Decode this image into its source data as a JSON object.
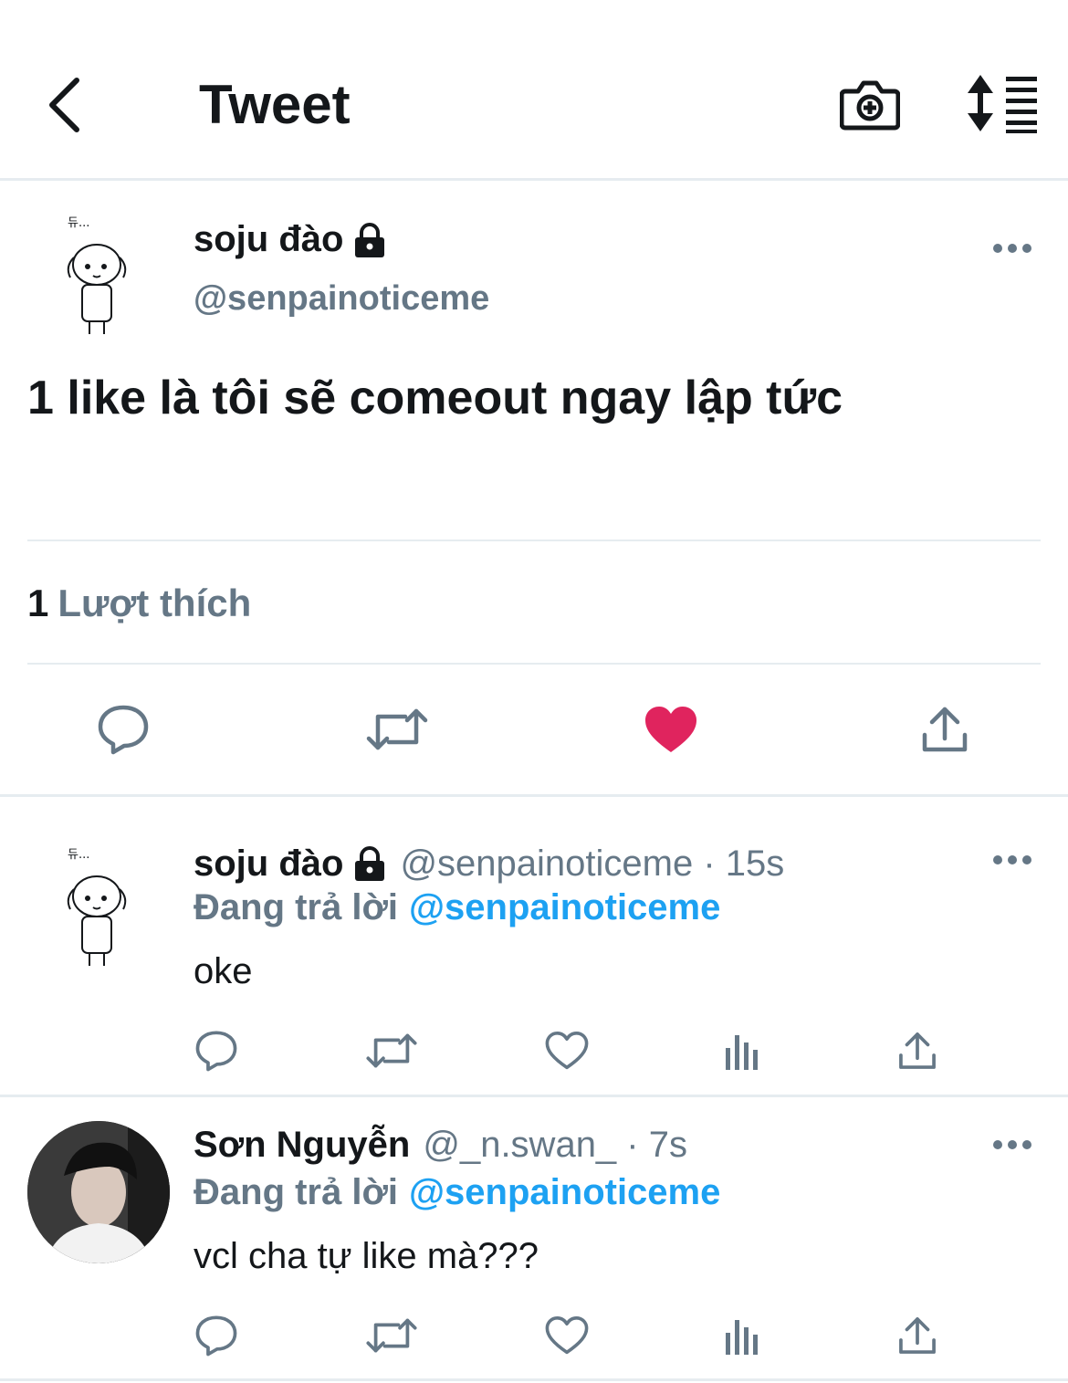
{
  "header": {
    "title": "Tweet",
    "back_icon": "chevron-left-icon",
    "camera_icon": "camera-plus-icon",
    "sort_icon": "sort-lines-icon"
  },
  "main_tweet": {
    "author_name": "soju đào",
    "handle": "@senpainoticeme",
    "text": "1 like là tôi sẽ comeout ngay lập tức",
    "likes_count": "1",
    "likes_label": "Lượt thích",
    "liked": true,
    "like_color": "#e0245e"
  },
  "replies": [
    {
      "author_name": "soju đào",
      "meta": "@senpainoticeme · 15s",
      "replying_label": "Đang trả lời",
      "replying_handle": "@senpainoticeme",
      "text": "oke"
    },
    {
      "author_name": "Sơn Nguyễn",
      "meta": "@_n.swan_ · 7s",
      "replying_label": "Đang trả lời",
      "replying_handle": "@senpainoticeme",
      "text": "vcl cha tự like mà???"
    }
  ],
  "colors": {
    "text": "#14171a",
    "secondary": "#657786",
    "accent": "#1da1f2",
    "divider": "#e6ecf0"
  }
}
